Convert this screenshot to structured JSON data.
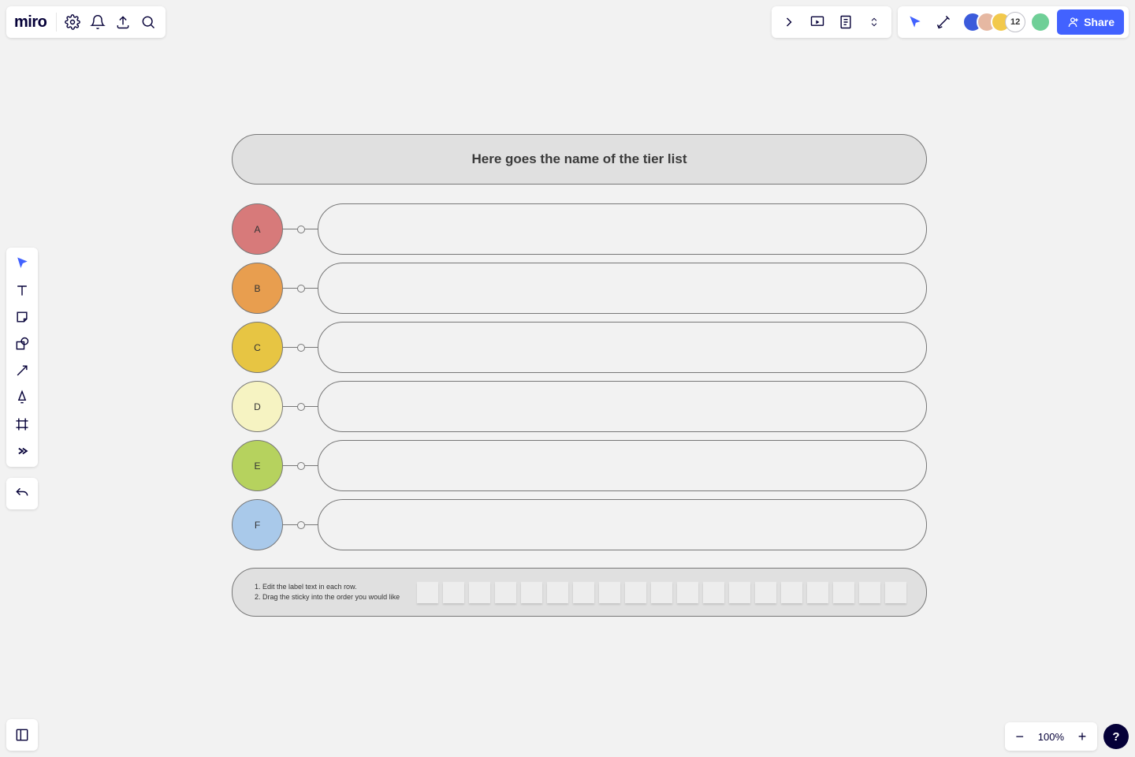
{
  "app": {
    "logo": "miro"
  },
  "header": {
    "share_label": "Share",
    "collaborator_count": "12"
  },
  "zoom": {
    "label": "100%"
  },
  "help": {
    "label": "?"
  },
  "tierlist": {
    "title": "Here goes the name of the tier list",
    "rows": [
      {
        "label": "A",
        "color": "#d77a7a"
      },
      {
        "label": "B",
        "color": "#e89e4f"
      },
      {
        "label": "C",
        "color": "#e7c543"
      },
      {
        "label": "D",
        "color": "#f6f3c2"
      },
      {
        "label": "E",
        "color": "#b6d25e"
      },
      {
        "label": "F",
        "color": "#a9c9ea"
      }
    ],
    "instructions": [
      "Edit the label text in each row.",
      "Drag the sticky into the order you would like"
    ],
    "sticky_count": 19
  }
}
